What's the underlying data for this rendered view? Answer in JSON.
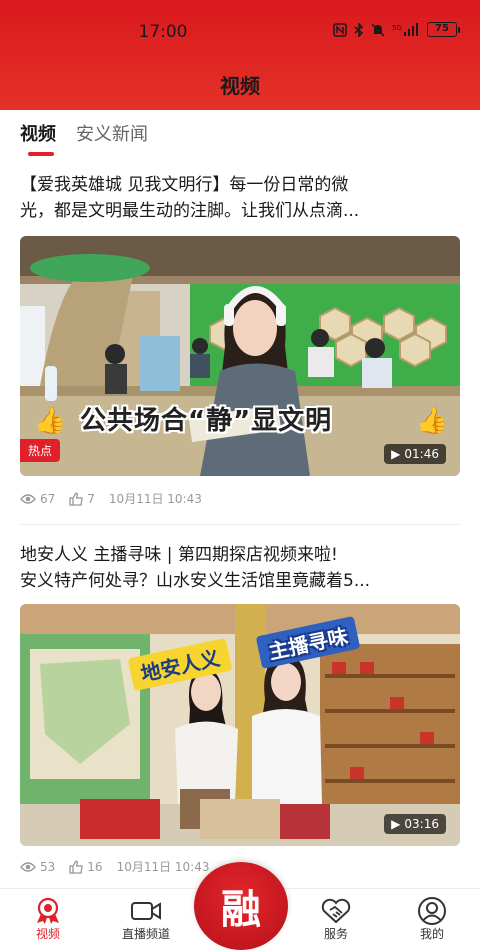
{
  "status_bar": {
    "time": "17:00",
    "battery": "75"
  },
  "header": {
    "title": "视频"
  },
  "tabs": [
    {
      "label": "视频",
      "active": true
    },
    {
      "label": "安义新闻",
      "active": false
    }
  ],
  "articles": [
    {
      "title_line1": "【爱我英雄城 见我文明行】每一份日常的微",
      "title_line2": "光，都是文明最生动的注脚。让我们从点滴...",
      "caption": "公共场合“静”显文明",
      "badge": "热点",
      "duration": "01:46",
      "views": "67",
      "likes": "7",
      "date": "10月11日 10:43"
    },
    {
      "title_line1": "地安人义 主播寻味 | 第四期探店视频来啦!",
      "title_line2": "安义特产何处寻？山水安义生活馆里竟藏着5...",
      "caption_left": "地安人义",
      "caption_right": "主播寻味",
      "duration": "03:16",
      "views": "53",
      "likes": "16",
      "date": "10月11日 10:43"
    }
  ],
  "bottom_nav": {
    "items": [
      {
        "label": "视频",
        "icon": "video-ribbon-icon"
      },
      {
        "label": "直播频道",
        "icon": "camera-icon"
      },
      {
        "label": "融",
        "icon": "rong-logo"
      },
      {
        "label": "服务",
        "icon": "handshake-icon"
      },
      {
        "label": "我的",
        "icon": "user-icon"
      }
    ]
  },
  "colors": {
    "accent": "#e0202b",
    "header": "#d9191e"
  }
}
